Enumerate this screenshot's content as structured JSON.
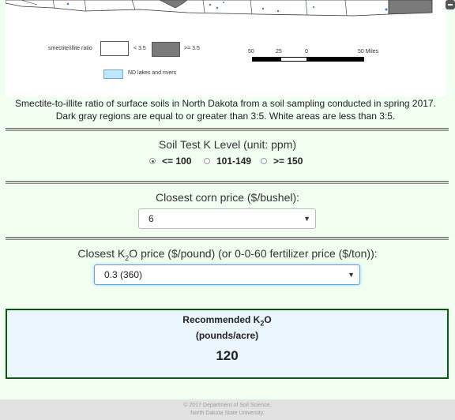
{
  "map": {
    "legend_ratio_label": "smectite/illite ratio",
    "legend_lt": "< 3.5",
    "legend_ge": ">= 3.5",
    "legend_water": "ND lakes and rivers",
    "scale_labels": [
      "50",
      "25",
      "0",
      "50 Miles"
    ],
    "colors": {
      "low": "#ffffff",
      "high": "#7a7a7a",
      "water": "#bfe6ff"
    }
  },
  "caption": {
    "line1": "Smectite-to-illite ratio of surface soils in North Dakota from a soil sampling conducted in spring 2017.",
    "line2": "Dark gray regions are equal to or greater than 3:5. White areas are less than 3:5."
  },
  "soil_test": {
    "label": "Soil Test K Level (unit: ppm)",
    "options": [
      "<= 100",
      "101-149",
      ">= 150"
    ],
    "selected_index": 0
  },
  "corn_price": {
    "label": "Closest corn price ($/bushel):",
    "value": "6"
  },
  "k2o_price": {
    "label_prefix": "Closest K",
    "label_sub": "2",
    "label_suffix": "O price ($/pound) (or 0-0-60 fertilizer price ($/ton)):",
    "value": "0.3 (360)"
  },
  "result": {
    "title_prefix": "Recommended K",
    "title_sub": "2",
    "title_suffix": "O",
    "units": "(pounds/acre)",
    "value": "120"
  },
  "footer": {
    "line1": "© 2017 Department of Soil Science,",
    "line2": "North Dakota State University."
  }
}
